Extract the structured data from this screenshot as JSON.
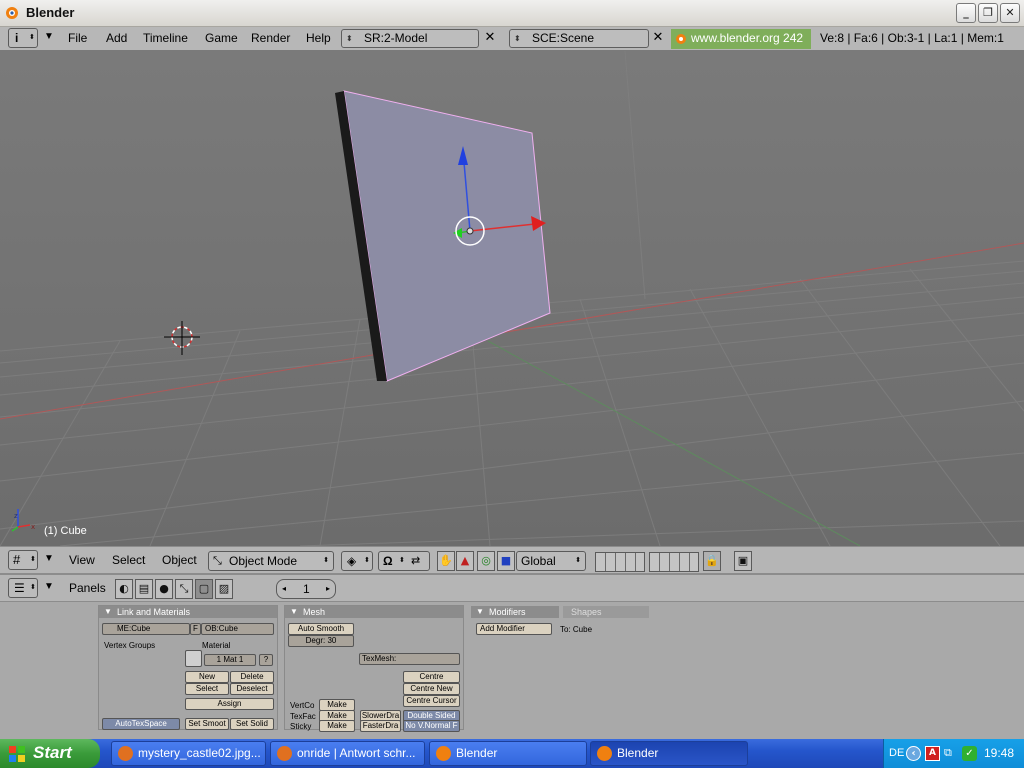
{
  "window": {
    "title": "Blender",
    "minimize": "_",
    "maximize": "❐",
    "close": "✕"
  },
  "header": {
    "menus": [
      "File",
      "Add",
      "Timeline",
      "Game",
      "Render",
      "Help"
    ],
    "screen": "SR:2-Model",
    "scene": "SCE:Scene",
    "site": "www.blender.org 242",
    "stats": "Ve:8 | Fa:6 | Ob:3-1 | La:1  | Mem:1"
  },
  "viewport": {
    "object_label": "(1) Cube"
  },
  "view3d_header": {
    "menus": [
      "View",
      "Select",
      "Object"
    ],
    "mode": "Object Mode",
    "orientation": "Global"
  },
  "buttons_header": {
    "panels_label": "Panels",
    "frame": "1"
  },
  "panels": {
    "link": {
      "title": "Link and Materials",
      "me": "ME:Cube",
      "f": "F",
      "ob": "OB:Cube",
      "vertex_groups": "Vertex Groups",
      "material": "Material",
      "mat": "1 Mat 1",
      "q": "?",
      "new": "New",
      "delete": "Delete",
      "select": "Select",
      "deselect": "Deselect",
      "assign": "Assign",
      "autotex": "AutoTexSpace",
      "set_smooth": "Set Smoot",
      "set_solid": "Set Solid"
    },
    "mesh": {
      "title": "Mesh",
      "auto_smooth": "Auto Smooth",
      "degr": "Degr: 30",
      "texmesh": "TexMesh:",
      "centre": "Centre",
      "centre_new": "Centre New",
      "centre_cursor": "Centre Cursor",
      "double_sided": "Double Sided",
      "no_vnormal": "No V.Normal F",
      "vertco": "VertCo",
      "texfac": "TexFac",
      "sticky": "Sticky",
      "make": "Make",
      "slower": "SlowerDra",
      "faster": "FasterDra"
    },
    "modifiers": {
      "tab1": "Modifiers",
      "tab2": "Shapes",
      "add": "Add Modifier",
      "to": "To: Cube"
    }
  },
  "taskbar": {
    "start": "Start",
    "tasks": [
      "mystery_castle02.jpg...",
      "onride | Antwort schr...",
      "Blender",
      "Blender"
    ],
    "lang": "DE",
    "clock": "19:48"
  }
}
